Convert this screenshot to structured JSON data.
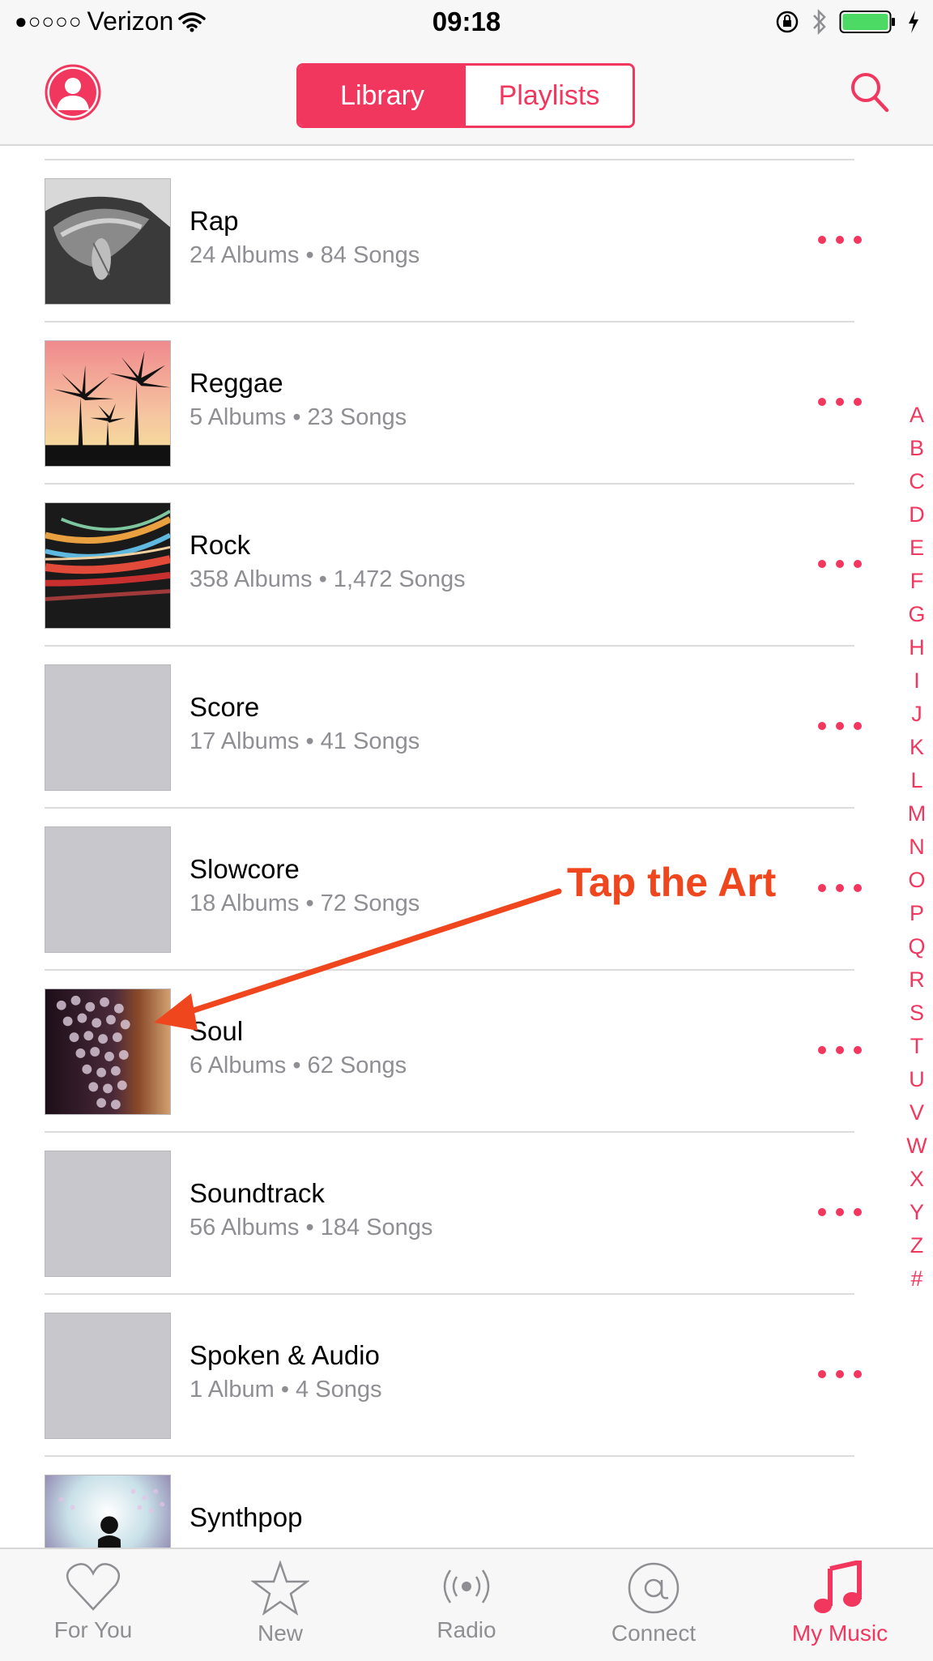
{
  "status_bar": {
    "signal_dots": "●○○○○",
    "carrier": "Verizon",
    "time": "09:18",
    "icons": [
      "wifi-icon",
      "rotation-lock-icon",
      "bluetooth-icon",
      "battery-icon",
      "charging-bolt-icon"
    ],
    "battery_color": "#4cd964"
  },
  "header": {
    "profile_icon": "profile-icon",
    "segments": [
      {
        "label": "Library",
        "active": true
      },
      {
        "label": "Playlists",
        "active": false
      }
    ],
    "search_icon": "search-icon"
  },
  "genres": [
    {
      "title": "Rap",
      "subtitle": "24 Albums • 84 Songs",
      "art": "hand-photo"
    },
    {
      "title": "Reggae",
      "subtitle": "5 Albums • 23 Songs",
      "art": "palm-trees"
    },
    {
      "title": "Rock",
      "subtitle": "358 Albums • 1,472 Songs",
      "art": "light-streaks"
    },
    {
      "title": "Score",
      "subtitle": "17 Albums • 41 Songs",
      "art": "placeholder"
    },
    {
      "title": "Slowcore",
      "subtitle": "18 Albums • 72 Songs",
      "art": "placeholder"
    },
    {
      "title": "Soul",
      "subtitle": "6 Albums • 62 Songs",
      "art": "bokeh"
    },
    {
      "title": "Soundtrack",
      "subtitle": "56 Albums • 184 Songs",
      "art": "placeholder"
    },
    {
      "title": "Spoken & Audio",
      "subtitle": "1 Album • 4 Songs",
      "art": "placeholder"
    },
    {
      "title": "Synthpop",
      "subtitle": "",
      "art": "silhouette"
    }
  ],
  "index_letters": [
    "A",
    "B",
    "C",
    "D",
    "E",
    "F",
    "G",
    "H",
    "I",
    "J",
    "K",
    "L",
    "M",
    "N",
    "O",
    "P",
    "Q",
    "R",
    "S",
    "T",
    "U",
    "V",
    "W",
    "X",
    "Y",
    "Z",
    "#"
  ],
  "annotation": {
    "text": "Tap the Art",
    "color": "#f0461e"
  },
  "tabs": [
    {
      "label": "For You",
      "icon": "heart-icon",
      "active": false
    },
    {
      "label": "New",
      "icon": "star-icon",
      "active": false
    },
    {
      "label": "Radio",
      "icon": "radio-icon",
      "active": false
    },
    {
      "label": "Connect",
      "icon": "at-sign-icon",
      "active": false
    },
    {
      "label": "My Music",
      "icon": "music-note-icon",
      "active": true
    }
  ],
  "colors": {
    "accent": "#f2375f",
    "secondary_text": "#8e8e93",
    "placeholder_art": "#c8c7cc"
  }
}
